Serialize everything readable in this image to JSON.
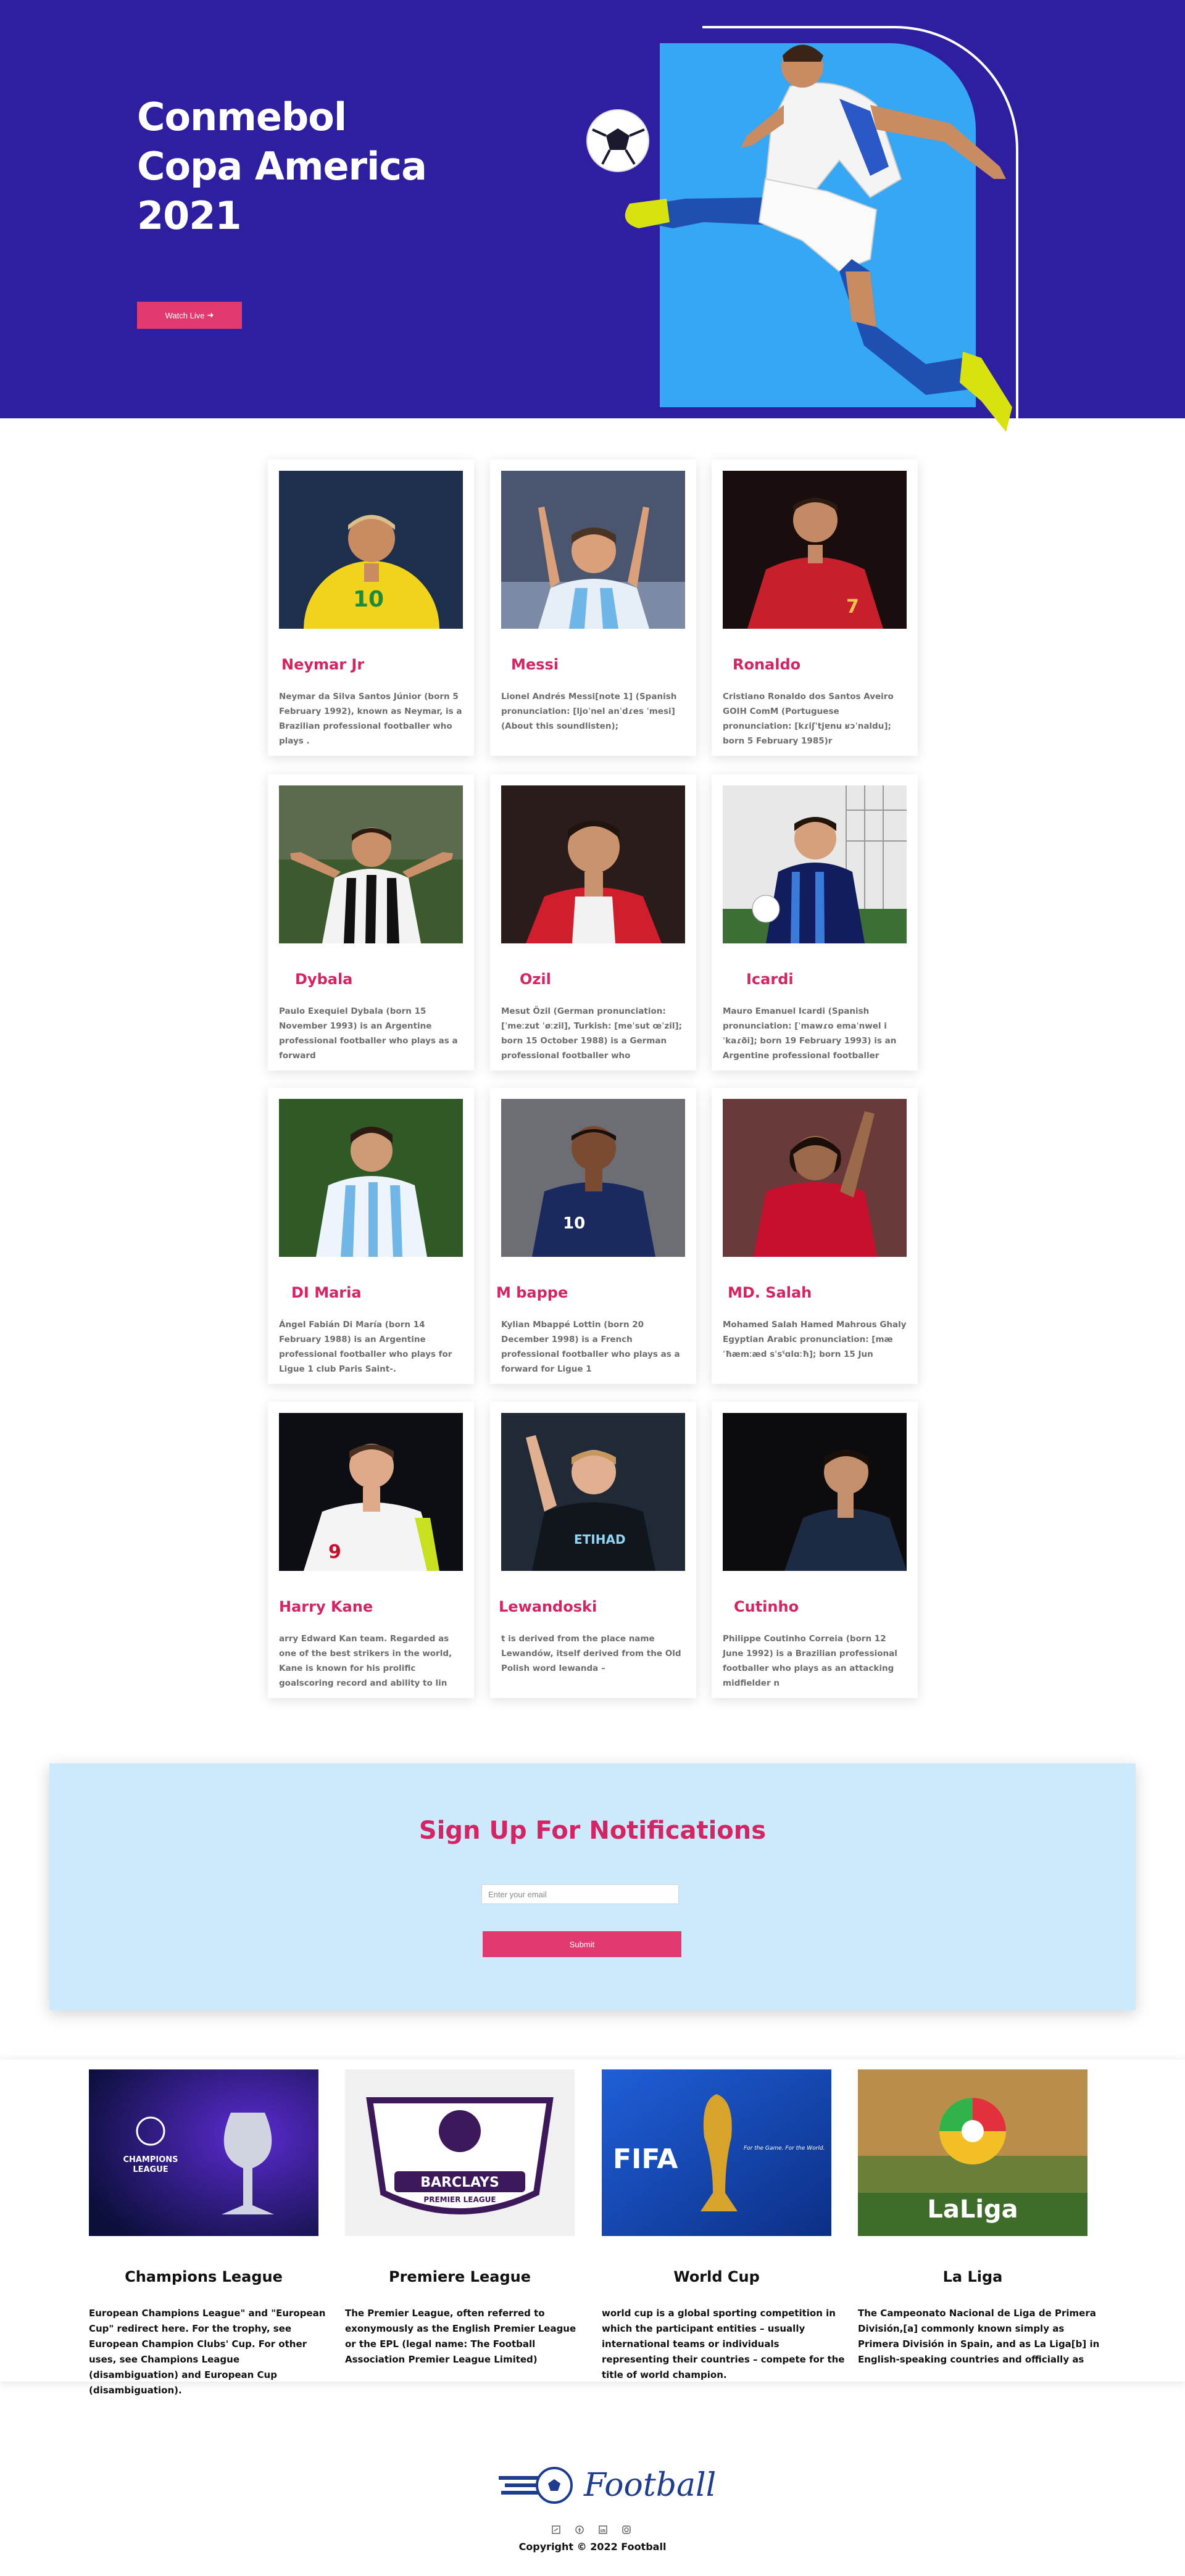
{
  "hero": {
    "title_lines": [
      "Conmebol",
      "Copa America",
      "2021"
    ],
    "watch_label": "Watch Live",
    "watch_icon": "arrow-right-icon",
    "colors": {
      "background": "#2d1fa0",
      "accent": "#e23a6f",
      "panel": "#35a7f4"
    }
  },
  "players": [
    {
      "name": "Neymar Jr",
      "desc": "Neymar da Silva Santos Júnior (born 5 February 1992), known as Neymar, is a Brazilian professional footballer who plays ."
    },
    {
      "name": "Messi",
      "desc": "Lionel Andrés Messi[note 1] (Spanish pronunciation: [ljoˈnel anˈdɾes ˈmesi] (About this soundlisten);"
    },
    {
      "name": "Ronaldo",
      "desc": "Cristiano Ronaldo dos Santos Aveiro GOIH ComM (Portuguese pronunciation: [kɾiʃˈtjɐnu ʁɔˈnaldu]; born 5 February 1985)r"
    },
    {
      "name": "Dybala",
      "desc": "Paulo Exequiel Dybala (born 15 November 1993) is an Argentine professional footballer who plays as a forward"
    },
    {
      "name": "Ozil",
      "desc": "Mesut Özil (German pronunciation: [ˈmeːzut ˈøːzil], Turkish: [meˈsut œˈzil]; born 15 October 1988) is a German professional footballer who"
    },
    {
      "name": "Icardi",
      "desc": "Mauro Emanuel Icardi (Spanish pronunciation: [ˈmawɾo emaˈnwel iˈkaɾði]; born 19 February 1993) is an Argentine professional footballer"
    },
    {
      "name": "DI Maria",
      "desc": "Ángel Fabián Di María (born 14 February 1988) is an Argentine professional footballer who plays for Ligue 1 club Paris Saint-."
    },
    {
      "name": "M bappe",
      "desc": "Kylian Mbappé Lottin (born 20 December 1998) is a French professional footballer who plays as a forward for Ligue 1"
    },
    {
      "name": "MD. Salah",
      "desc": "Mohamed Salah Hamed Mahrous Ghaly Egyptian Arabic pronunciation: [mæˈħæmːæd sˈsˤɑlɑːħ]; born 15 Jun"
    },
    {
      "name": "Harry Kane",
      "desc": "arry Edward Kan team. Regarded as one of the best strikers in the world, Kane is known for his prolific goalscoring record and ability to lin"
    },
    {
      "name": "Lewandoski",
      "desc": "t is derived from the place name Lewandów, itself derived from the Old Polish word lewanda –"
    },
    {
      "name": "Cutinho",
      "desc": "Philippe Coutinho Correia (born 12 June 1992) is a Brazilian professional footballer who plays as an attacking midfielder n"
    }
  ],
  "signup": {
    "title": "Sign Up For Notifications",
    "email_placeholder": "Enter your email",
    "submit_label": "Submit"
  },
  "leagues": [
    {
      "title": "Champions League",
      "image_text": "CHAMPIONS LEAGUE",
      "desc": "European Champions League\" and \"European Cup\" redirect here. For the trophy, see European Champion Clubs' Cup. For other uses, see Champions League (disambiguation) and European Cup (disambiguation)."
    },
    {
      "title": "Premiere League",
      "image_text_1": "BARCLAYS",
      "image_text_2": "PREMIER LEAGUE",
      "desc": "The Premier League, often referred to exonymously as the English Premier League or the EPL (legal name: The Football Association Premier League Limited)"
    },
    {
      "title": "World Cup",
      "image_text_1": "FIFA",
      "image_text_2": "For the Game. For the World.",
      "desc": "world cup is a global sporting competition in which the participant entities – usually international teams or individuals representing their countries – compete for the title of world champion."
    },
    {
      "title": "La Liga",
      "image_text": "LaLiga",
      "desc": "The Campeonato Nacional de Liga de Primera División,[a] commonly known simply as Primera División in Spain, and as La Liga[b] in English-speaking countries and officially as"
    }
  ],
  "footer": {
    "brand": "Football",
    "socials": [
      "twitter-icon",
      "facebook-icon",
      "linkedin-icon",
      "instagram-icon"
    ],
    "copyright": "Copyright © 2022 Football"
  }
}
